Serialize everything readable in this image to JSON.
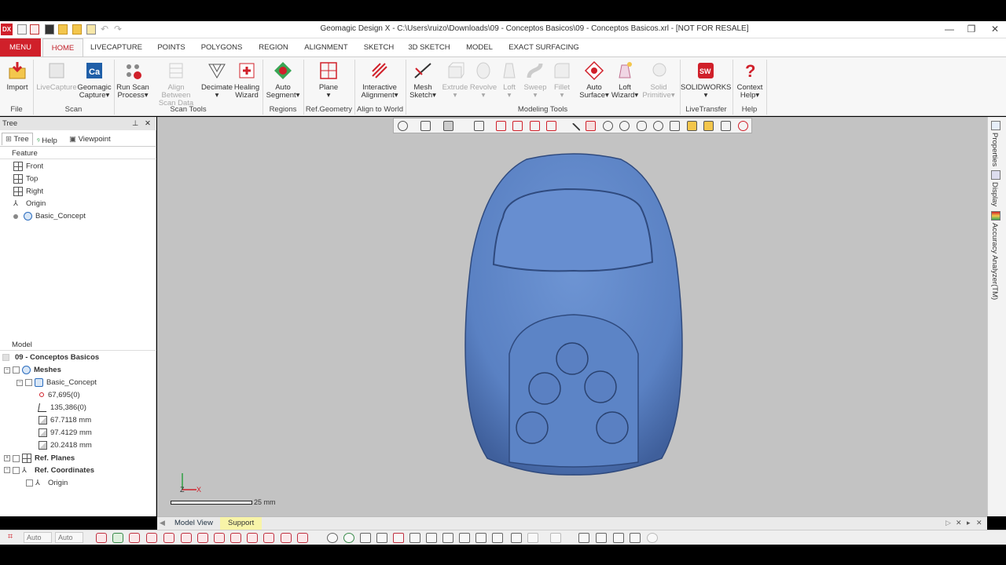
{
  "app": {
    "logo": "DX",
    "title": "Geomagic Design X - C:\\Users\\ruizo\\Downloads\\09 - Conceptos Basicos\\09 - Conceptos Basicos.xrl - [NOT FOR RESALE]",
    "window_controls": [
      "—",
      "❐",
      "✕"
    ]
  },
  "tabs": [
    "MENU",
    "HOME",
    "LIVECAPTURE",
    "POINTS",
    "POLYGONS",
    "REGION",
    "ALIGNMENT",
    "SKETCH",
    "3D SKETCH",
    "MODEL",
    "EXACT SURFACING"
  ],
  "active_tab": "HOME",
  "ribbon": {
    "buttons": [
      {
        "l1": "Import",
        "l2": ""
      },
      {
        "l1": "LiveCapture",
        "l2": ""
      },
      {
        "l1": "Geomagic",
        "l2": "Capture▾"
      },
      {
        "l1": "Run Scan",
        "l2": "Process▾"
      },
      {
        "l1": "Align Between",
        "l2": "Scan Data"
      },
      {
        "l1": "Decimate",
        "l2": ""
      },
      {
        "l1": "Healing",
        "l2": "Wizard"
      },
      {
        "l1": "Auto",
        "l2": "Segment▾"
      },
      {
        "l1": "Plane",
        "l2": "▾"
      },
      {
        "l1": "Interactive",
        "l2": "Alignment▾"
      },
      {
        "l1": "Mesh",
        "l2": "Sketch▾"
      },
      {
        "l1": "Extrude",
        "l2": "▾"
      },
      {
        "l1": "Revolve",
        "l2": "▾"
      },
      {
        "l1": "Loft",
        "l2": "▾"
      },
      {
        "l1": "Sweep",
        "l2": "▾"
      },
      {
        "l1": "Fillet",
        "l2": "▾"
      },
      {
        "l1": "Auto",
        "l2": "Surface▾"
      },
      {
        "l1": "Loft",
        "l2": "Wizard▾"
      },
      {
        "l1": "Solid",
        "l2": "Primitive▾"
      },
      {
        "l1": "SOLIDWORKS",
        "l2": "▾"
      },
      {
        "l1": "Context",
        "l2": "Help▾"
      }
    ],
    "groups": [
      "File",
      "Scan",
      "Scan Tools",
      "Regions",
      "Ref.Geometry",
      "Align to World",
      "Modeling Tools",
      "LiveTransfer",
      "Help"
    ]
  },
  "tree_panel": {
    "header": "Tree",
    "header_icons": [
      "pin-icon",
      "close-icon"
    ],
    "tabs": [
      "Tree",
      "Help",
      "Viewpoint"
    ],
    "feature_label": "Feature",
    "features": [
      "Front",
      "Top",
      "Right",
      "Origin",
      "Basic_Concept"
    ],
    "model_label": "Model",
    "model_root": "09 - Conceptos Basicos",
    "model_rows": [
      "Meshes",
      "Basic_Concept",
      "67,695(0)",
      "135,386(0)",
      "67.7118 mm",
      "97.4129 mm",
      "20.2418 mm",
      "Ref. Planes",
      "Ref. Coordinates",
      "Origin"
    ]
  },
  "viewport": {
    "scale_label": "25 mm",
    "axis_x": "X",
    "axis_z": "Z"
  },
  "right_dock": [
    "Properties",
    "Display",
    "Accuracy Analyzer(TM)"
  ],
  "bottom_tabs": [
    "Model View",
    "Support"
  ],
  "statusbar": {
    "auto1": "Auto",
    "auto2": "Auto"
  },
  "colors": {
    "accent": "#d0202a",
    "mesh": "#5f86c8",
    "viewport_bg": "#c3c3c3"
  }
}
